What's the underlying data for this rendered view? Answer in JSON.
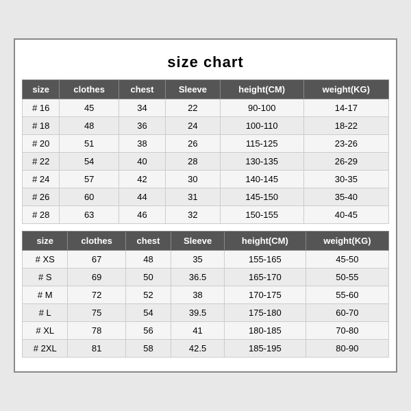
{
  "title": "size chart",
  "table1": {
    "headers": [
      "size",
      "clothes",
      "chest",
      "Sleeve",
      "height(CM)",
      "weight(KG)"
    ],
    "rows": [
      [
        "# 16",
        "45",
        "34",
        "22",
        "90-100",
        "14-17"
      ],
      [
        "# 18",
        "48",
        "36",
        "24",
        "100-110",
        "18-22"
      ],
      [
        "# 20",
        "51",
        "38",
        "26",
        "115-125",
        "23-26"
      ],
      [
        "# 22",
        "54",
        "40",
        "28",
        "130-135",
        "26-29"
      ],
      [
        "# 24",
        "57",
        "42",
        "30",
        "140-145",
        "30-35"
      ],
      [
        "# 26",
        "60",
        "44",
        "31",
        "145-150",
        "35-40"
      ],
      [
        "# 28",
        "63",
        "46",
        "32",
        "150-155",
        "40-45"
      ]
    ]
  },
  "table2": {
    "headers": [
      "size",
      "clothes",
      "chest",
      "Sleeve",
      "height(CM)",
      "weight(KG)"
    ],
    "rows": [
      [
        "# XS",
        "67",
        "48",
        "35",
        "155-165",
        "45-50"
      ],
      [
        "# S",
        "69",
        "50",
        "36.5",
        "165-170",
        "50-55"
      ],
      [
        "# M",
        "72",
        "52",
        "38",
        "170-175",
        "55-60"
      ],
      [
        "# L",
        "75",
        "54",
        "39.5",
        "175-180",
        "60-70"
      ],
      [
        "# XL",
        "78",
        "56",
        "41",
        "180-185",
        "70-80"
      ],
      [
        "# 2XL",
        "81",
        "58",
        "42.5",
        "185-195",
        "80-90"
      ]
    ]
  }
}
